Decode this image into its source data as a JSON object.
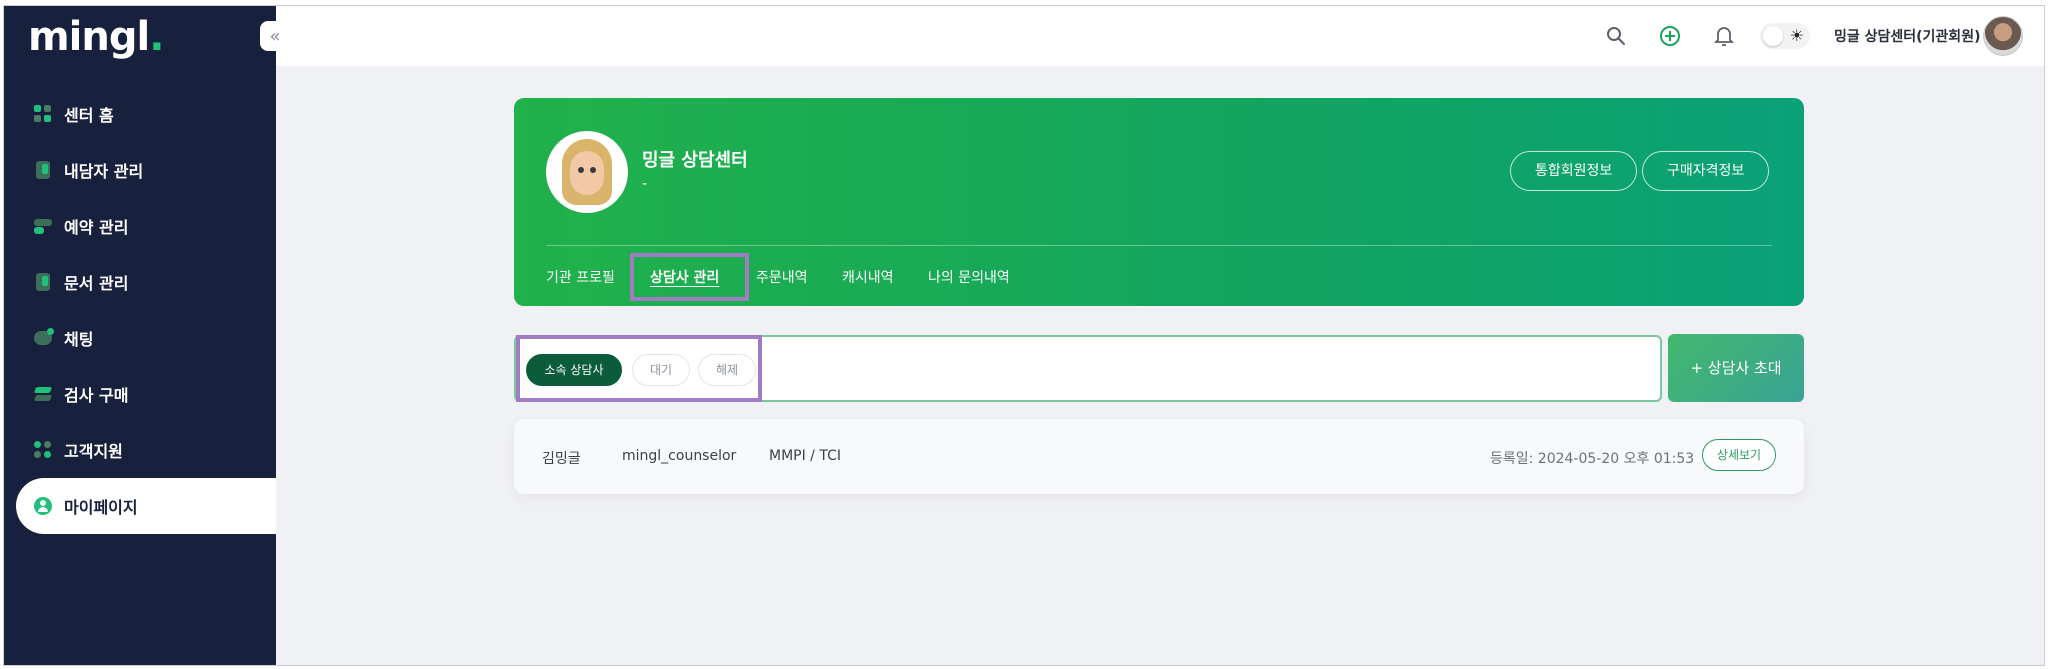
{
  "brand": {
    "logo_text": "mingl",
    "logo_dot": ".",
    "accent": "#1ec07a",
    "sidebar_bg": "#17213d"
  },
  "sidebar": {
    "collapse_icon": "double-chevron-left-icon",
    "items": [
      {
        "label": "센터 홈",
        "icon": "dashboard-icon"
      },
      {
        "label": "내담자 관리",
        "icon": "client-icon"
      },
      {
        "label": "예약 관리",
        "icon": "calendar-toggle-icon"
      },
      {
        "label": "문서 관리",
        "icon": "document-icon"
      },
      {
        "label": "채팅",
        "icon": "chat-icon"
      },
      {
        "label": "검사 구매",
        "icon": "layers-icon"
      },
      {
        "label": "고객지원",
        "icon": "support-icon"
      },
      {
        "label": "마이페이지",
        "icon": "person-icon",
        "active": true
      }
    ]
  },
  "header": {
    "icons": [
      "search-icon",
      "add-circle-icon",
      "bell-icon"
    ],
    "theme_toggle": "sun-icon",
    "user_name": "밍글 상담센터(기관회원)"
  },
  "hero": {
    "title": "밍글 상담센터",
    "subtitle": "-",
    "buttons": [
      "통합회원정보",
      "구매자격정보"
    ],
    "tabs": [
      {
        "label": "기관 프로필"
      },
      {
        "label": "상담사 관리",
        "active": true
      },
      {
        "label": "주문내역"
      },
      {
        "label": "캐시내역"
      },
      {
        "label": "나의 문의내역"
      }
    ]
  },
  "filters": [
    {
      "label": "소속 상담사",
      "active": true
    },
    {
      "label": "대기"
    },
    {
      "label": "해제"
    }
  ],
  "invite_button": "+ 상담사 초대",
  "counselors": [
    {
      "name": "김밍글",
      "username": "mingl_counselor",
      "tests": "MMPI / TCI",
      "registered": "등록일: 2024-05-20 오후 01:53",
      "action": "상세보기"
    }
  ]
}
